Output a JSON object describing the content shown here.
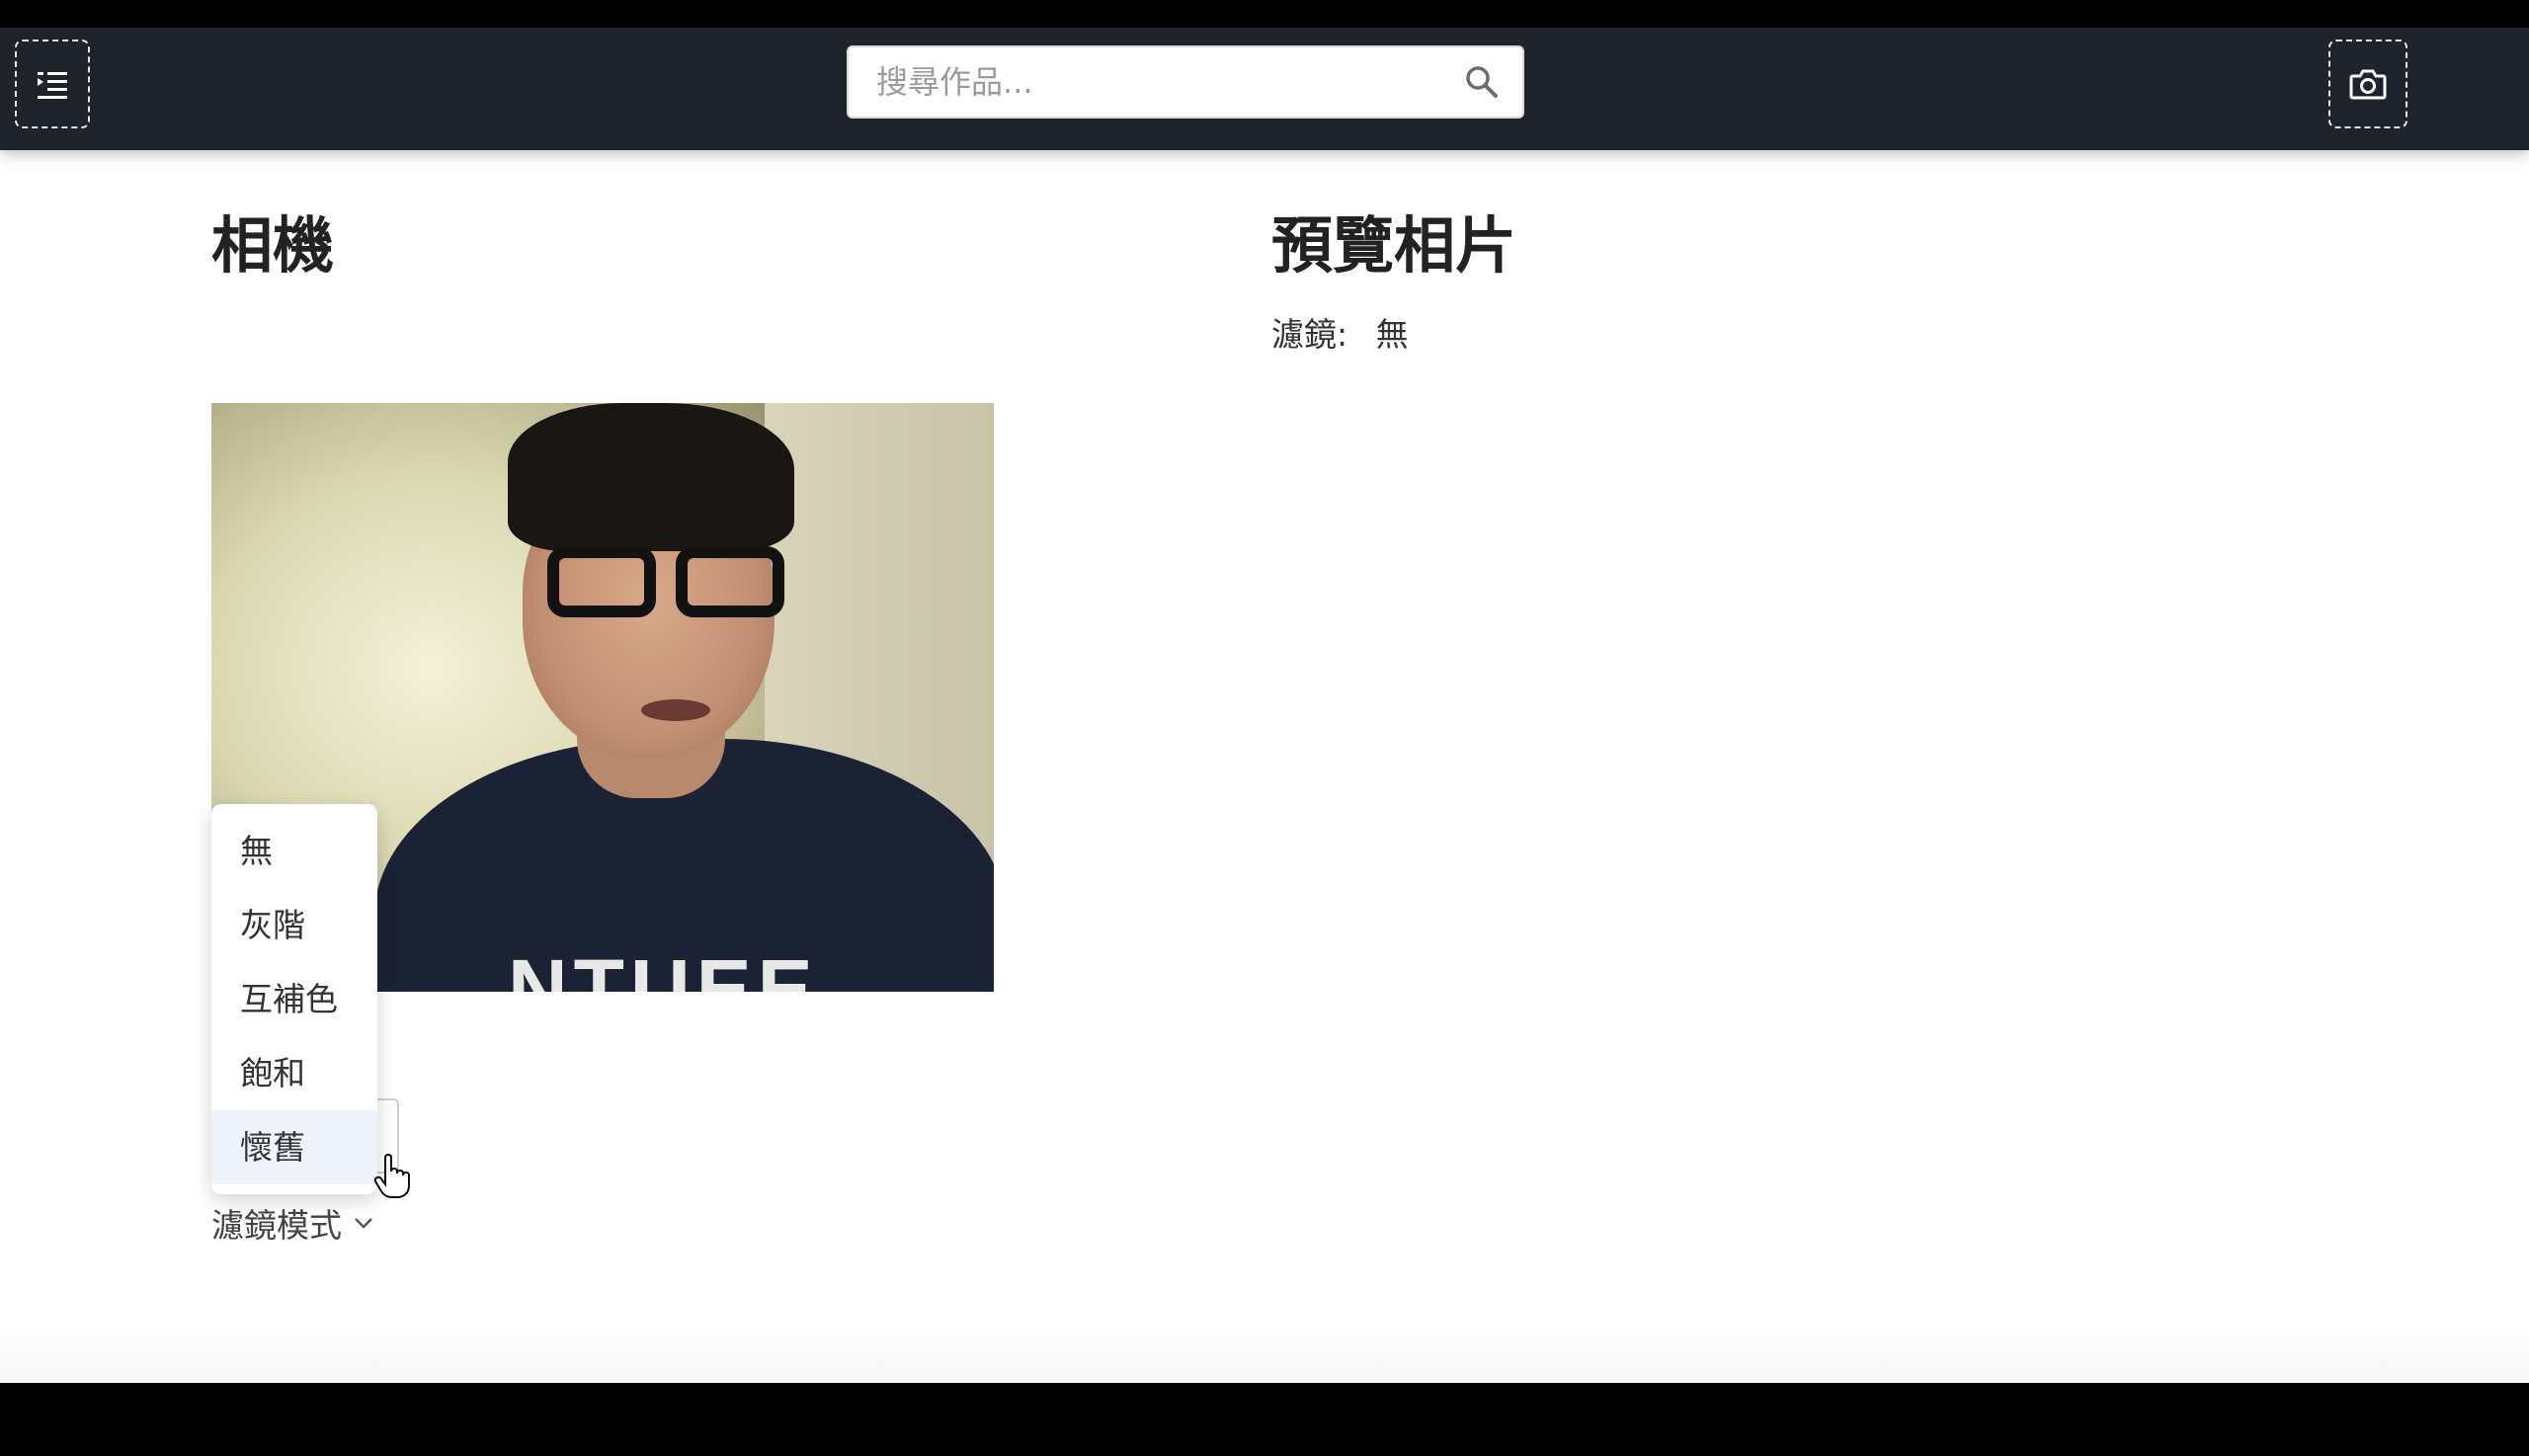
{
  "header": {
    "menu_icon": "menu-icon",
    "search": {
      "placeholder": "搜尋作品...",
      "icon": "search-icon"
    },
    "camera_icon": "camera-icon"
  },
  "camera_section": {
    "title": "相機",
    "select": {
      "label": "濾鏡模式",
      "options": [
        "無",
        "灰階",
        "互補色",
        "飽和",
        "懷舊"
      ],
      "hovered_option": "懷舊",
      "shirt_text": "NTUEE"
    }
  },
  "preview_section": {
    "title": "預覽相片",
    "filter_label": "濾鏡:",
    "filter_value": "無"
  },
  "colors": {
    "topbar": "#1f232b",
    "background": "#ffffff",
    "text": "#222222"
  }
}
